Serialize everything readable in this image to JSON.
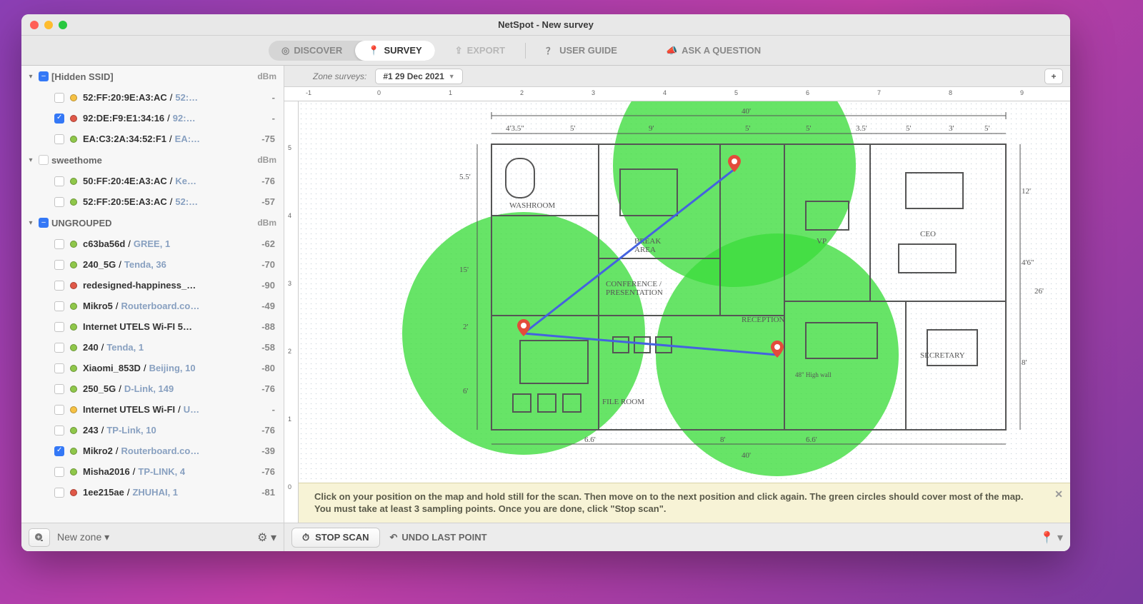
{
  "window": {
    "title": "NetSpot - New survey"
  },
  "toolbar": {
    "discover": "DISCOVER",
    "survey": "SURVEY",
    "export": "EXPORT",
    "user_guide": "USER GUIDE",
    "ask": "ASK A QUESTION"
  },
  "survey_bar": {
    "label": "Zone surveys:",
    "selected": "#1 29 Dec 2021"
  },
  "ruler_h": [
    "-1",
    "0",
    "1",
    "2",
    "3",
    "4",
    "5",
    "6",
    "7",
    "8",
    "9"
  ],
  "ruler_v": [
    "5",
    "4",
    "3",
    "2",
    "1",
    "0"
  ],
  "sidebar": {
    "groups": [
      {
        "name": "[Hidden SSID]",
        "unit": "dBm",
        "check": "minus",
        "rows": [
          {
            "checked": false,
            "dot": "d-yellow",
            "name": "52:FF:20:9E:A3:AC",
            "vendor": "52:…",
            "dbm": "-"
          },
          {
            "checked": true,
            "dot": "d-red",
            "name": "92:DE:F9:E1:34:16",
            "vendor": "92:…",
            "dbm": "-"
          },
          {
            "checked": false,
            "dot": "d-green",
            "name": "EA:C3:2A:34:52:F1",
            "vendor": "EA:…",
            "dbm": "-75"
          }
        ]
      },
      {
        "name": "sweethome",
        "unit": "dBm",
        "check": "blank",
        "rows": [
          {
            "checked": false,
            "dot": "d-green",
            "name": "50:FF:20:4E:A3:AC",
            "vendor": "Ke…",
            "dbm": "-76"
          },
          {
            "checked": false,
            "dot": "d-green",
            "name": "52:FF:20:5E:A3:AC",
            "vendor": "52:…",
            "dbm": "-57"
          }
        ]
      },
      {
        "name": "UNGROUPED",
        "unit": "dBm",
        "check": "minus",
        "rows": [
          {
            "checked": false,
            "dot": "d-green",
            "name": "c63ba56d",
            "vendor": "GREE, 1",
            "dbm": "-62"
          },
          {
            "checked": false,
            "dot": "d-green",
            "name": "240_5G",
            "vendor": "Tenda, 36",
            "dbm": "-70"
          },
          {
            "checked": false,
            "dot": "d-red",
            "name": "redesigned-happiness_…",
            "vendor": "",
            "dbm": "-90"
          },
          {
            "checked": false,
            "dot": "d-green",
            "name": "Mikro5",
            "vendor": "Routerboard.co…",
            "dbm": "-49"
          },
          {
            "checked": false,
            "dot": "d-green",
            "name": "Internet UTELS Wi-FI 5…",
            "vendor": "",
            "dbm": "-88"
          },
          {
            "checked": false,
            "dot": "d-green",
            "name": "240",
            "vendor": "Tenda, 1",
            "dbm": "-58"
          },
          {
            "checked": false,
            "dot": "d-green",
            "name": "Xiaomi_853D",
            "vendor": "Beijing, 10",
            "dbm": "-80"
          },
          {
            "checked": false,
            "dot": "d-green",
            "name": "250_5G",
            "vendor": "D-Link, 149",
            "dbm": "-76"
          },
          {
            "checked": false,
            "dot": "d-yellow",
            "name": "Internet UTELS Wi-FI",
            "vendor": "U…",
            "dbm": "-"
          },
          {
            "checked": false,
            "dot": "d-green",
            "name": "243",
            "vendor": "TP-Link, 10",
            "dbm": "-76"
          },
          {
            "checked": true,
            "dot": "d-green",
            "name": "Mikro2",
            "vendor": "Routerboard.co…",
            "dbm": "-39"
          },
          {
            "checked": false,
            "dot": "d-green",
            "name": "Misha2016",
            "vendor": "TP-LINK, 4",
            "dbm": "-76"
          },
          {
            "checked": false,
            "dot": "d-red",
            "name": "1ee215ae",
            "vendor": "ZHUHAI, 1",
            "dbm": "-81"
          }
        ]
      }
    ]
  },
  "sidebar_footer": {
    "zone_label": "New zone ▾"
  },
  "hint": {
    "text": "Click on your position on the map and hold still for the scan. Then move on to the next position and click again. The green circles should cover most of the map. You must take at least 3 sampling points. Once you are done, click \"Stop scan\"."
  },
  "main_footer": {
    "stop": "STOP SCAN",
    "undo": "UNDO LAST POINT"
  },
  "floorplan_labels": {
    "washroom": "WASHROOM",
    "break": "BREAK AREA",
    "conf": "CONFERENCE / PRESENTATION",
    "file": "FILE ROOM",
    "reception": "RECEPTION",
    "vp": "VP",
    "ceo": "CEO",
    "secretary": "SECRETARY",
    "wall_note": "48\" High wall",
    "dim_top": "40'",
    "dim_right1": "12'",
    "dim_right2": "26'",
    "dim_right3": "4'6\"",
    "dim_right4": "8'",
    "dim_s1": "4'3.5\"",
    "dim_s2": "5'",
    "dim_s3": "9'",
    "dim_s4": "5'",
    "dim_s5": "5'",
    "dim_s6": "3.5'",
    "dim_s7": "5'",
    "dim_s8": "3'",
    "dim_s9": "5'",
    "dim_left1": "5.5'",
    "dim_left2": "15'",
    "dim_left3": "2'",
    "dim_left4": "6'",
    "dim_btm1": "6.6'",
    "dim_btm2": "8'",
    "dim_btm3": "6.6'",
    "dim_btmtot": "40'"
  }
}
